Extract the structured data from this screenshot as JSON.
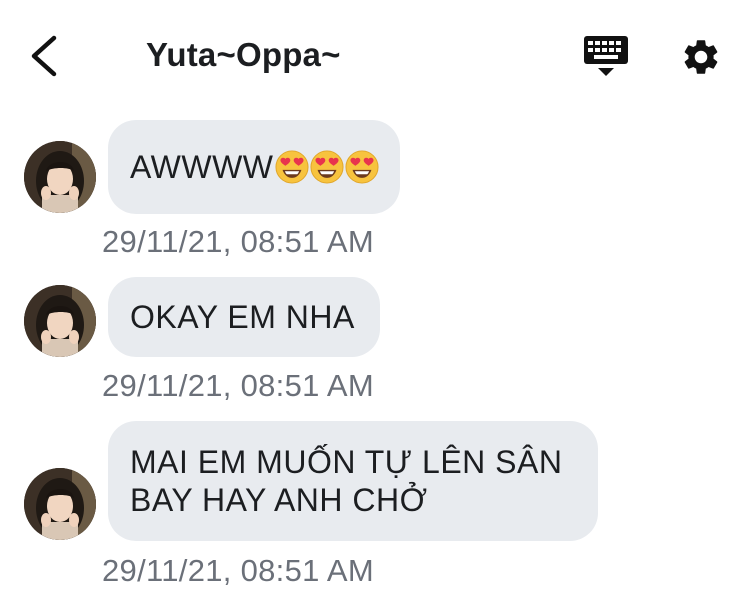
{
  "header": {
    "title": "Yuta~Oppa~",
    "back_icon": "chevron-left-icon",
    "keyboard_icon": "keyboard-icon",
    "settings_icon": "gear-icon"
  },
  "messages": [
    {
      "text": "AWWWW",
      "emojis": [
        "heart-eyes-emoji",
        "heart-eyes-emoji",
        "heart-eyes-emoji"
      ],
      "timestamp": "29/11/21, 08:51 AM"
    },
    {
      "text": "OKAY EM NHA",
      "timestamp": "29/11/21, 08:51 AM"
    },
    {
      "line1": "MAI EM MUỐN TỰ LÊN SÂN",
      "line2": "BAY HAY ANH CHỞ",
      "timestamp": "29/11/21, 08:51 AM"
    }
  ],
  "colors": {
    "bubble": "#e8ebef",
    "timestamp": "#6b7079",
    "emoji_face": "#f7c33e",
    "emoji_heart": "#e8344d"
  }
}
